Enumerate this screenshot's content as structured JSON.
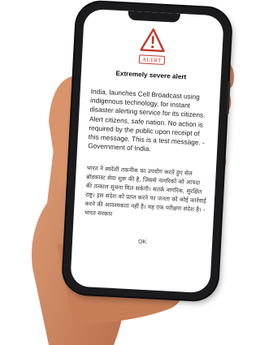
{
  "alert": {
    "badge": "ALERT",
    "title": "Extremely severe alert",
    "message_en": "India, launches Cell Broadcast using indigenous technology, for instant disaster alerting service for its citizens. Alert citizens, safe nation. No action is required by the public upon receipt of this message. This is a test message. - Government of India.",
    "message_hi": "भारत ने स्वदेशी तकनीक का उपयोग करते हुए सेल ब्रॉडकास्ट सेवा शुरू की है, जिससे नागरिकों को आपदा की तत्काल सूचना मिल सकेगी। सतर्क नागरिक, सुरक्षित राष्ट्र। इस संदेश को प्राप्त करने पर जनता को कोई कार्रवाई करने की आवश्यकता नहीं है। यह एक परीक्षण संदेश है। - भारत सरकार",
    "ok_label": "OK",
    "icon": "warning-triangle-icon",
    "accent_color": "#c0392b"
  }
}
